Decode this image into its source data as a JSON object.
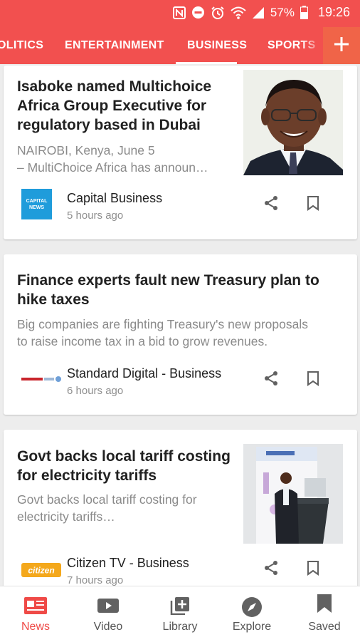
{
  "status_bar": {
    "battery_percent": "57%",
    "time": "19:26",
    "icons": [
      "nfc-icon",
      "do-not-disturb-icon",
      "alarm-icon",
      "wifi-icon",
      "signal-icon",
      "battery-icon"
    ]
  },
  "tabs": [
    {
      "label": "OLITICS"
    },
    {
      "label": "ENTERTAINMENT"
    },
    {
      "label": "BUSINESS",
      "active": true
    },
    {
      "label": "SPORTS"
    }
  ],
  "articles": [
    {
      "headline_lines": [
        "Isaboke named Multichoice",
        "Africa Group Executive for",
        "regulatory based in Dubai"
      ],
      "summary_lines": [
        "NAIROBI, Kenya, June 5",
        "– MultiChoice Africa has announ…"
      ],
      "source": "Capital Business",
      "time": "5 hours ago",
      "logo_text": [
        "CAPITAL",
        "NEWS"
      ]
    },
    {
      "headline_lines": [
        "Finance experts fault new Treasury plan to",
        "hike taxes"
      ],
      "summary_lines": [
        "Big companies are fighting Treasury's new proposals",
        "to raise income tax in a bid to grow revenues."
      ],
      "source": "Standard Digital - Business",
      "time": "6 hours ago"
    },
    {
      "headline_lines": [
        "Govt backs local tariff costing",
        "for electricity tariffs"
      ],
      "summary_lines": [
        "Govt backs local tariff costing for",
        "electricity tariffs…"
      ],
      "source": "Citizen TV - Business",
      "time": "7 hours ago",
      "logo_text": [
        "citizen"
      ]
    }
  ],
  "bottom_nav": [
    {
      "label": "News",
      "icon": "news-icon",
      "active": true
    },
    {
      "label": "Video",
      "icon": "video-icon"
    },
    {
      "label": "Library",
      "icon": "library-icon"
    },
    {
      "label": "Explore",
      "icon": "compass-icon"
    },
    {
      "label": "Saved",
      "icon": "bookmark-icon"
    }
  ],
  "colors": {
    "brand": "#f2504f",
    "active_nav": "#ef4a47",
    "background": "#ededed"
  }
}
